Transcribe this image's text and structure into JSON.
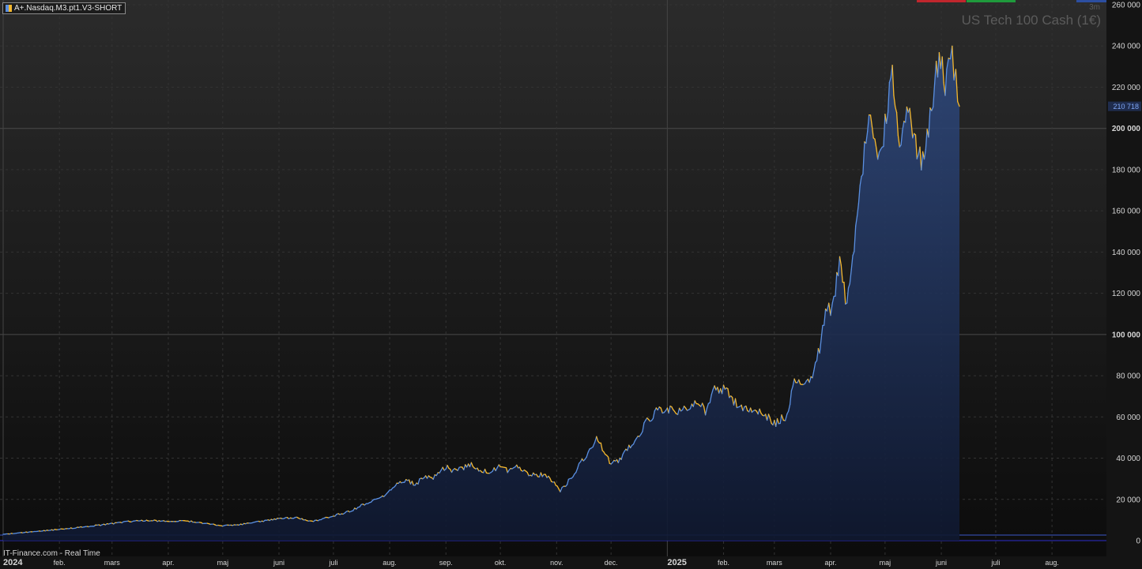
{
  "header": {
    "instrument_tag": "A+.Nasdaq.M3.pt1.V3-SHORT",
    "title": "US Tech 100 Cash (1€)",
    "timeframe": "3m"
  },
  "footer": {
    "source": "IT-Finance.com - Real Time"
  },
  "colors": {
    "background": "#151515",
    "line_up": "#5a8fe0",
    "line_down": "#f5b82e",
    "fill": "#2a4373",
    "grid": "#333333",
    "last_price_bg": "#1f2c4d",
    "last_price_text": "#7ea6f5",
    "zero_line": "#2d2dcc"
  },
  "chart_data": {
    "type": "line",
    "title": "US Tech 100 Cash (1€)",
    "xlabel": "",
    "ylabel": "",
    "ylim": [
      0,
      260000
    ],
    "yticks": [
      0,
      20000,
      40000,
      60000,
      80000,
      100000,
      120000,
      140000,
      160000,
      180000,
      200000,
      220000,
      240000,
      260000
    ],
    "ytick_labels": [
      "0",
      "20 000",
      "40 000",
      "60 000",
      "80 000",
      "100 000",
      "120 000",
      "140 000",
      "160 000",
      "180 000",
      "200 000",
      "220 000",
      "240 000",
      "260 000"
    ],
    "xlim": [
      "2024-01-01",
      "2025-08-31"
    ],
    "x_ticks": [
      {
        "date": "2024-01-01",
        "label": "2024",
        "bold": true
      },
      {
        "date": "2024-02-01",
        "label": "feb."
      },
      {
        "date": "2024-03-01",
        "label": "mars"
      },
      {
        "date": "2024-04-01",
        "label": "apr."
      },
      {
        "date": "2024-05-01",
        "label": "maj"
      },
      {
        "date": "2024-06-01",
        "label": "juni"
      },
      {
        "date": "2024-07-01",
        "label": "juli"
      },
      {
        "date": "2024-08-01",
        "label": "aug."
      },
      {
        "date": "2024-09-01",
        "label": "sep."
      },
      {
        "date": "2024-10-01",
        "label": "okt."
      },
      {
        "date": "2024-11-01",
        "label": "nov."
      },
      {
        "date": "2024-12-01",
        "label": "dec."
      },
      {
        "date": "2025-01-01",
        "label": "2025",
        "bold": true
      },
      {
        "date": "2025-02-01",
        "label": "feb."
      },
      {
        "date": "2025-03-01",
        "label": "mars"
      },
      {
        "date": "2025-04-01",
        "label": "apr."
      },
      {
        "date": "2025-05-01",
        "label": "maj"
      },
      {
        "date": "2025-06-01",
        "label": "juni"
      },
      {
        "date": "2025-07-01",
        "label": "juli"
      },
      {
        "date": "2025-08-01",
        "label": "aug."
      }
    ],
    "last_price": {
      "value": 210718,
      "label": "210 718"
    },
    "series": [
      {
        "values": [
          [
            "2024-01-01",
            3000
          ],
          [
            "2024-01-10",
            3800
          ],
          [
            "2024-01-20",
            4500
          ],
          [
            "2024-02-01",
            5500
          ],
          [
            "2024-02-10",
            6200
          ],
          [
            "2024-02-20",
            7200
          ],
          [
            "2024-03-01",
            8200
          ],
          [
            "2024-03-10",
            9300
          ],
          [
            "2024-03-20",
            9800
          ],
          [
            "2024-04-01",
            9300
          ],
          [
            "2024-04-10",
            9700
          ],
          [
            "2024-04-20",
            8400
          ],
          [
            "2024-05-01",
            7200
          ],
          [
            "2024-05-10",
            7800
          ],
          [
            "2024-05-20",
            9100
          ],
          [
            "2024-06-01",
            10600
          ],
          [
            "2024-06-10",
            11200
          ],
          [
            "2024-06-20",
            9300
          ],
          [
            "2024-07-01",
            12000
          ],
          [
            "2024-07-10",
            14200
          ],
          [
            "2024-07-20",
            18500
          ],
          [
            "2024-07-28",
            21000
          ],
          [
            "2024-08-01",
            24000
          ],
          [
            "2024-08-05",
            27500
          ],
          [
            "2024-08-10",
            29500
          ],
          [
            "2024-08-15",
            27000
          ],
          [
            "2024-08-20",
            31000
          ],
          [
            "2024-08-25",
            30500
          ],
          [
            "2024-09-01",
            36000
          ],
          [
            "2024-09-05",
            33500
          ],
          [
            "2024-09-10",
            35000
          ],
          [
            "2024-09-15",
            37500
          ],
          [
            "2024-09-20",
            34000
          ],
          [
            "2024-09-25",
            33000
          ],
          [
            "2024-10-01",
            36500
          ],
          [
            "2024-10-05",
            34000
          ],
          [
            "2024-10-10",
            35500
          ],
          [
            "2024-10-15",
            33000
          ],
          [
            "2024-10-20",
            31500
          ],
          [
            "2024-10-25",
            32000
          ],
          [
            "2024-10-30",
            28500
          ],
          [
            "2024-11-03",
            24000
          ],
          [
            "2024-11-06",
            27000
          ],
          [
            "2024-11-10",
            32000
          ],
          [
            "2024-11-15",
            38500
          ],
          [
            "2024-11-20",
            44000
          ],
          [
            "2024-11-23",
            50000
          ],
          [
            "2024-11-27",
            43000
          ],
          [
            "2024-12-01",
            37500
          ],
          [
            "2024-12-05",
            38500
          ],
          [
            "2024-12-10",
            45000
          ],
          [
            "2024-12-15",
            48000
          ],
          [
            "2024-12-20",
            57000
          ],
          [
            "2024-12-25",
            62000
          ],
          [
            "2025-01-01",
            64000
          ],
          [
            "2025-01-05",
            63000
          ],
          [
            "2025-01-12",
            64000
          ],
          [
            "2025-01-17",
            68000
          ],
          [
            "2025-01-22",
            63000
          ],
          [
            "2025-01-27",
            73000
          ],
          [
            "2025-02-01",
            74000
          ],
          [
            "2025-02-05",
            69500
          ],
          [
            "2025-02-10",
            65000
          ],
          [
            "2025-02-15",
            63000
          ],
          [
            "2025-02-20",
            62500
          ],
          [
            "2025-02-25",
            60000
          ],
          [
            "2025-03-01",
            56500
          ],
          [
            "2025-03-05",
            59500
          ],
          [
            "2025-03-08",
            60500
          ],
          [
            "2025-03-12",
            78000
          ],
          [
            "2025-03-17",
            76000
          ],
          [
            "2025-03-22",
            80000
          ],
          [
            "2025-03-26",
            93000
          ],
          [
            "2025-03-30",
            115000
          ],
          [
            "2025-04-02",
            112000
          ],
          [
            "2025-04-06",
            135000
          ],
          [
            "2025-04-10",
            114000
          ],
          [
            "2025-04-14",
            140000
          ],
          [
            "2025-04-18",
            178000
          ],
          [
            "2025-04-23",
            210000
          ],
          [
            "2025-04-27",
            190000
          ],
          [
            "2025-05-01",
            200000
          ],
          [
            "2025-05-05",
            225000
          ],
          [
            "2025-05-09",
            188000
          ],
          [
            "2025-05-13",
            209000
          ],
          [
            "2025-05-17",
            198000
          ],
          [
            "2025-05-21",
            182000
          ],
          [
            "2025-05-25",
            200000
          ],
          [
            "2025-05-30",
            232000
          ],
          [
            "2025-06-04",
            222000
          ],
          [
            "2025-06-07",
            235000
          ],
          [
            "2025-06-09",
            226000
          ],
          [
            "2025-06-11",
            210718
          ]
        ]
      }
    ]
  }
}
